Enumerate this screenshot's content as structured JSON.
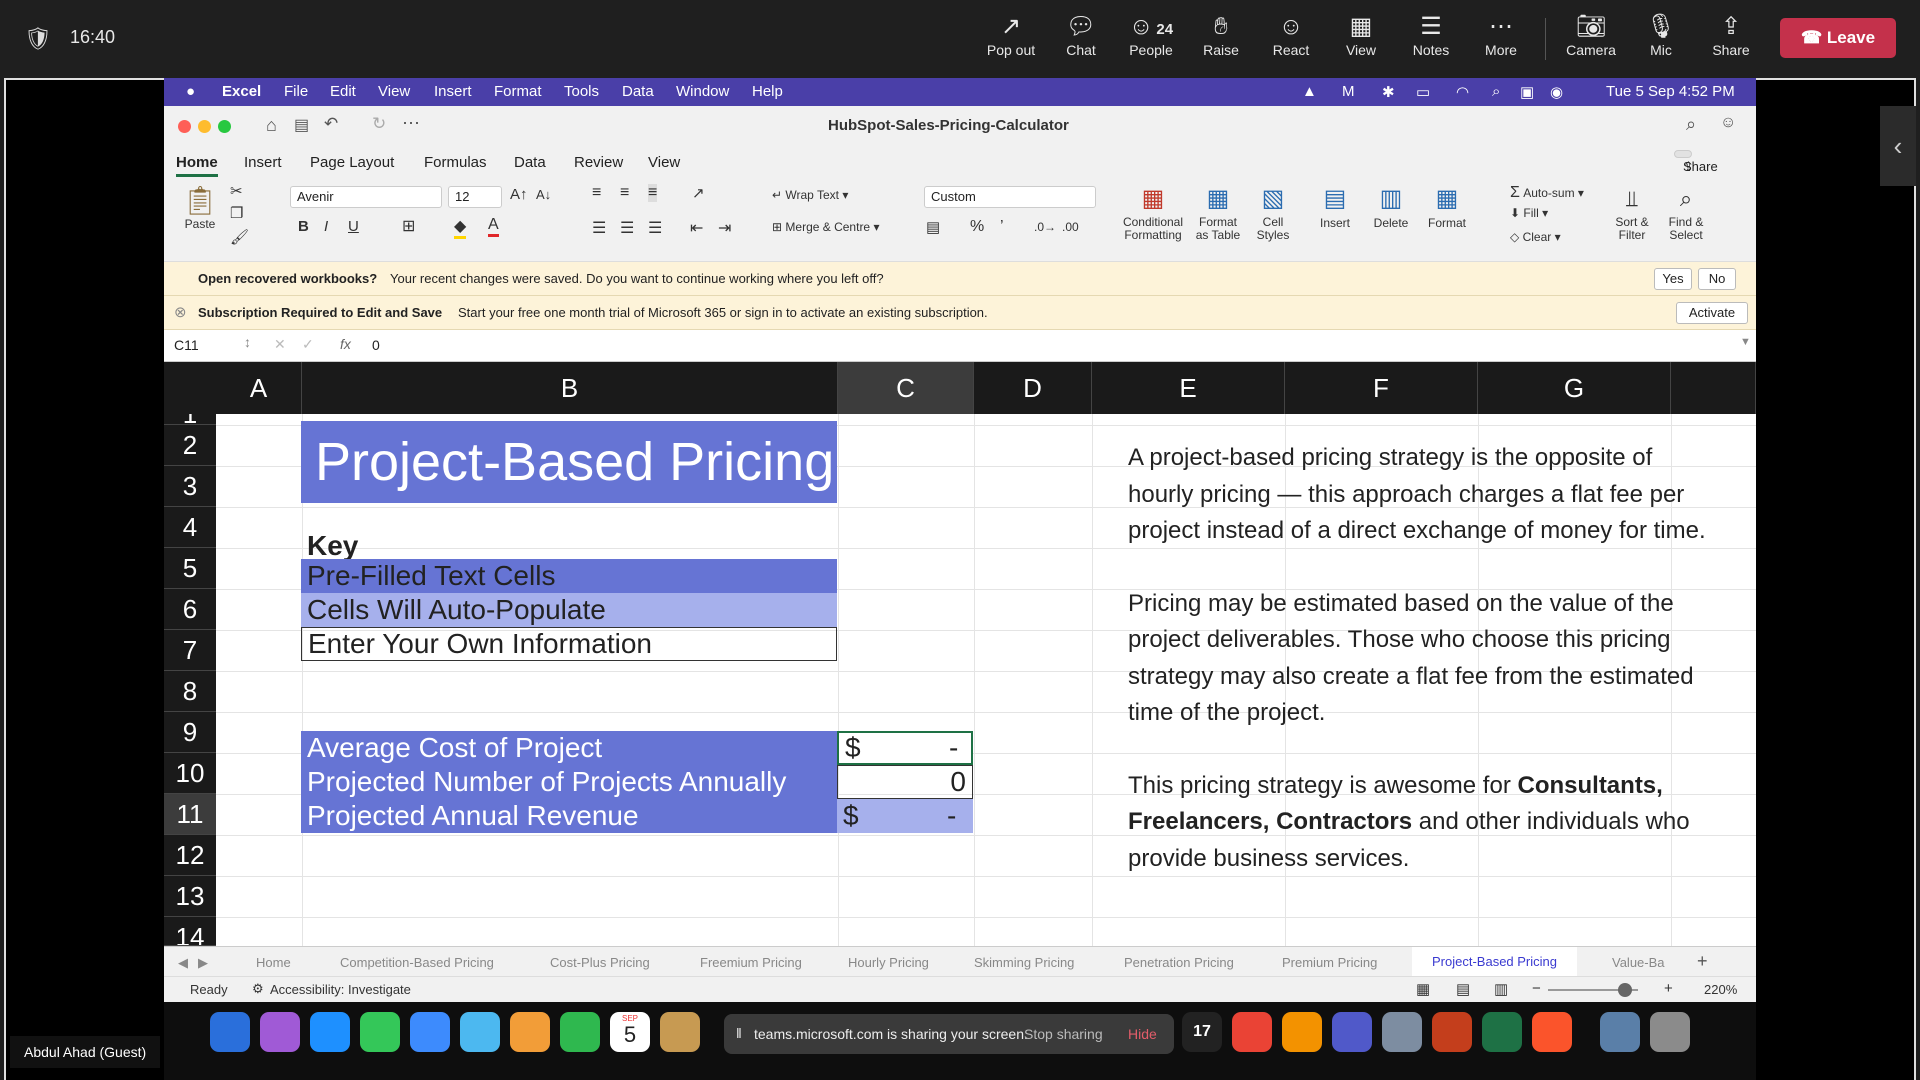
{
  "teams": {
    "time": "16:40",
    "buttons": [
      {
        "icon": "pop-out-icon",
        "label": "Pop out"
      },
      {
        "icon": "chat-icon",
        "label": "Chat"
      },
      {
        "icon": "people-icon",
        "label": "People",
        "count": "24"
      },
      {
        "icon": "raise-hand-icon",
        "label": "Raise"
      },
      {
        "icon": "react-icon",
        "label": "React"
      },
      {
        "icon": "view-icon",
        "label": "View"
      },
      {
        "icon": "notes-icon",
        "label": "Notes"
      },
      {
        "icon": "more-icon",
        "label": "More"
      },
      {
        "icon": "camera-off-icon",
        "label": "Camera"
      },
      {
        "icon": "mic-off-icon",
        "label": "Mic"
      },
      {
        "icon": "share-icon",
        "label": "Share"
      }
    ],
    "leave_label": "Leave",
    "guest_name": "Abdul Ahad (Guest)"
  },
  "mac_menu": {
    "app": "Excel",
    "items": [
      "File",
      "Edit",
      "View",
      "Insert",
      "Format",
      "Tools",
      "Data",
      "Window",
      "Help"
    ],
    "clock": "Tue 5 Sep  4:52 PM"
  },
  "excel": {
    "doc_title": "HubSpot-Sales-Pricing-Calculator",
    "ribbon_tabs": [
      "Home",
      "Insert",
      "Page Layout",
      "Formulas",
      "Data",
      "Review",
      "View"
    ],
    "share_label": "Share",
    "font_name": "Avenir",
    "font_size": "12",
    "number_format": "Custom",
    "ribbon_labels": {
      "paste": "Paste",
      "wrap_text": "Wrap Text",
      "merge_centre": "Merge & Centre",
      "conditional": "Conditional",
      "formatting": "Formatting",
      "format_as": "Format",
      "as_table": "as Table",
      "cell": "Cell",
      "styles": "Styles",
      "insert": "Insert",
      "delete": "Delete",
      "format": "Format",
      "auto_sum": "Auto-sum",
      "fill": "Fill",
      "clear": "Clear",
      "sort": "Sort &",
      "filter": "Filter",
      "find": "Find &",
      "select": "Select"
    },
    "recover_bar": {
      "title": "Open recovered workbooks?",
      "message": "Your recent changes were saved. Do you want to continue working where you left off?",
      "yes": "Yes",
      "no": "No"
    },
    "subscription_bar": {
      "title": "Subscription Required to Edit and Save",
      "message": "Start your free one month trial of Microsoft 365 or sign in to activate an existing subscription.",
      "activate": "Activate"
    },
    "formula_bar": {
      "cell_ref": "C11",
      "fx": "fx",
      "value": "0"
    },
    "columns": [
      "A",
      "B",
      "C",
      "D",
      "E",
      "F",
      "G"
    ],
    "rows": [
      "1",
      "2",
      "3",
      "4",
      "5",
      "6",
      "7",
      "8",
      "9",
      "10",
      "11",
      "12",
      "13",
      "14"
    ],
    "title_cell": "Project-Based Pricing",
    "key_label": "Key",
    "key_items": [
      "Pre-Filled Text Cells",
      "Cells Will Auto-Populate",
      "Enter Your Own Information"
    ],
    "calc_rows": [
      {
        "label": "Average Cost of Project",
        "currency": "$",
        "value": "-"
      },
      {
        "label": "Projected Number of Projects Annually",
        "currency": "",
        "value": "0"
      },
      {
        "label": "Projected Annual Revenue",
        "currency": "$",
        "value": "-"
      }
    ],
    "description": {
      "p1": "A project-based pricing strategy is the opposite of hourly pricing — this approach charges a flat fee per project instead of a direct exchange of money for time.",
      "p2": "Pricing may be estimated based on the value of the project deliverables. Those who choose this pricing strategy may also create a flat fee from the estimated time of the project.",
      "p3_start": "This pricing strategy is awesome for ",
      "p3_bold": "Consultants, Freelancers, Contractors",
      "p3_end": " and other individuals who provide business services."
    },
    "sheet_tabs": [
      "Home",
      "Competition-Based Pricing",
      "Cost-Plus Pricing",
      "Freemium Pricing",
      "Hourly Pricing",
      "Skimming Pricing",
      "Penetration Pricing",
      "Premium Pricing",
      "Project-Based Pricing",
      "Value-Ba"
    ],
    "active_sheet": "Project-Based Pricing",
    "status": {
      "ready": "Ready",
      "accessibility": "Accessibility: Investigate",
      "zoom": "220%"
    }
  },
  "dock": {
    "share_message": "teams.microsoft.com is sharing your screen.",
    "stop_sharing": "Stop sharing",
    "hide": "Hide",
    "calendar_day": "5",
    "calendar_month": "SEP"
  },
  "colors": {
    "menubar": "#4a3fa8",
    "prefilled": "#6674d4",
    "autopopulate": "#a6b0ec",
    "leave": "#c4314b",
    "active_tab": "#3a3ad0"
  }
}
